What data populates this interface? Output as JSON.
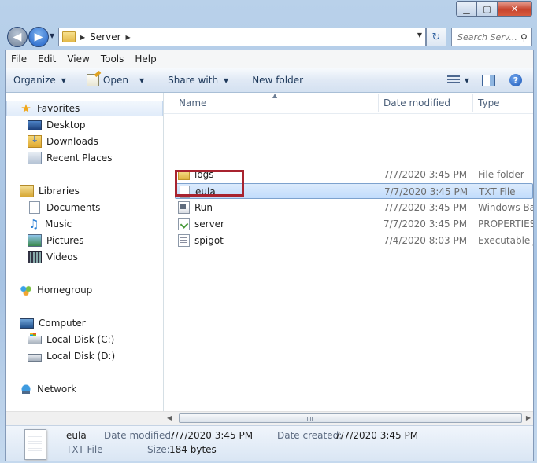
{
  "window": {
    "controls": {
      "minimize": "▁",
      "maximize": "▢",
      "close": "✕"
    }
  },
  "address": {
    "location": "Server",
    "search_placeholder": "Search Serv..."
  },
  "menu": [
    "File",
    "Edit",
    "View",
    "Tools",
    "Help"
  ],
  "toolbar": {
    "organize": "Organize",
    "open": "Open",
    "share_with": "Share with",
    "new_folder": "New folder"
  },
  "nav": {
    "favorites": {
      "label": "Favorites",
      "items": [
        "Desktop",
        "Downloads",
        "Recent Places"
      ]
    },
    "libraries": {
      "label": "Libraries",
      "items": [
        "Documents",
        "Music",
        "Pictures",
        "Videos"
      ]
    },
    "homegroup": "Homegroup",
    "computer": {
      "label": "Computer",
      "items": [
        "Local Disk (C:)",
        "Local Disk (D:)"
      ]
    },
    "network": "Network"
  },
  "columns": {
    "name": "Name",
    "date_modified": "Date modified",
    "type": "Type"
  },
  "files": [
    {
      "name": "logs",
      "date": "7/7/2020 3:45 PM",
      "type": "File folder",
      "icon": "folder-icon"
    },
    {
      "name": "eula",
      "date": "7/7/2020 3:45 PM",
      "type": "TXT File",
      "icon": "text-file-icon"
    },
    {
      "name": "Run",
      "date": "7/7/2020 3:45 PM",
      "type": "Windows Bat",
      "icon": "batch-file-icon"
    },
    {
      "name": "server",
      "date": "7/7/2020 3:45 PM",
      "type": "PROPERTIES",
      "icon": "properties-file-icon"
    },
    {
      "name": "spigot",
      "date": "7/4/2020 8:03 PM",
      "type": "Executable Ja",
      "icon": "jar-file-icon"
    }
  ],
  "selected_index": 1,
  "details": {
    "name": "eula",
    "type": "TXT File",
    "date_modified_label": "Date modified:",
    "date_modified": "7/7/2020 3:45 PM",
    "date_created_label": "Date created:",
    "date_created": "7/7/2020 3:45 PM",
    "size_label": "Size:",
    "size": "184 bytes"
  },
  "colors": {
    "highlight_box": "#a8232f",
    "selection": "#c1dcfc",
    "toolbar_text": "#1e395b"
  }
}
